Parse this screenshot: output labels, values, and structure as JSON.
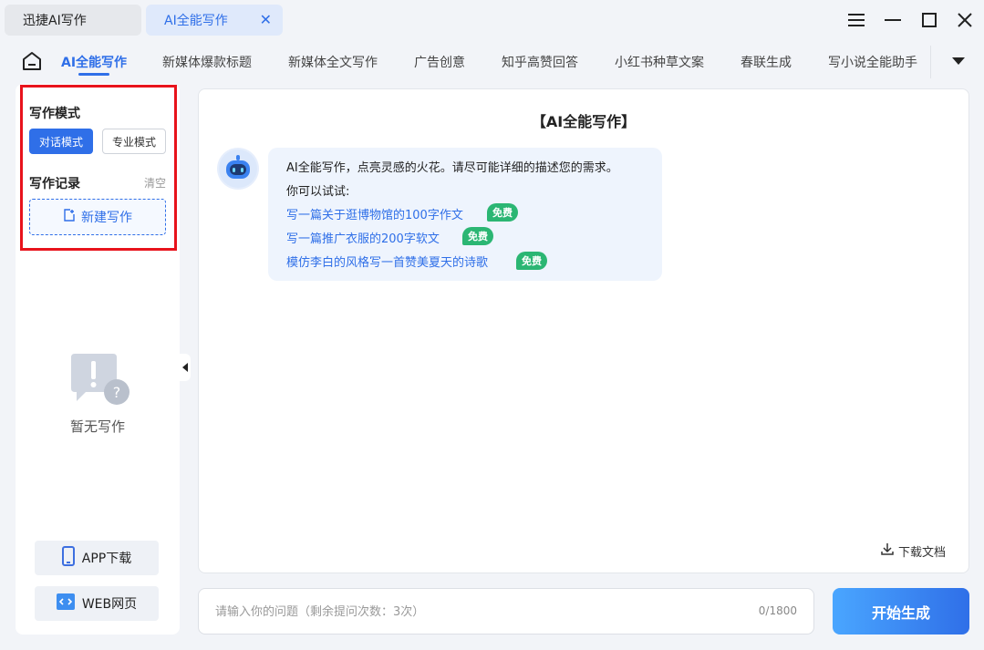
{
  "tabs": [
    {
      "label": "迅捷AI写作"
    },
    {
      "label": "AI全能写作",
      "close": "✕"
    }
  ],
  "nav": {
    "items": [
      "AI全能写作",
      "新媒体爆款标题",
      "新媒体全文写作",
      "广告创意",
      "知乎高赞回答",
      "小红书种草文案",
      "春联生成",
      "写小说全能助手"
    ]
  },
  "sidebar": {
    "mode_heading": "写作模式",
    "mode_chat": "对话模式",
    "mode_pro": "专业模式",
    "records_heading": "写作记录",
    "clear": "清空",
    "new_writing": "新建写作",
    "empty_text": "暂无写作",
    "app_download": "APP下载",
    "web_page": "WEB网页"
  },
  "main": {
    "title": "【AI全能写作】",
    "greeting": "AI全能写作，点亮灵感的火花。请尽可能详细的描述您的需求。",
    "try_label": "你可以试试:",
    "suggestions": [
      {
        "text": "写一篇关于逛博物馆的100字作文",
        "badge": "免费"
      },
      {
        "text": "写一篇推广衣服的200字软文",
        "badge": "免费"
      },
      {
        "text": "模仿李白的风格写一首赞美夏天的诗歌",
        "badge": "免费"
      }
    ],
    "download_doc": "下载文档"
  },
  "input": {
    "placeholder": "请输入你的问题（剩余提问次数：3次）",
    "value": "",
    "counter": "0/1800",
    "submit": "开始生成"
  },
  "colors": {
    "accent": "#2f6fe8",
    "badge": "#2bb673",
    "highlight": "#e8131c"
  }
}
